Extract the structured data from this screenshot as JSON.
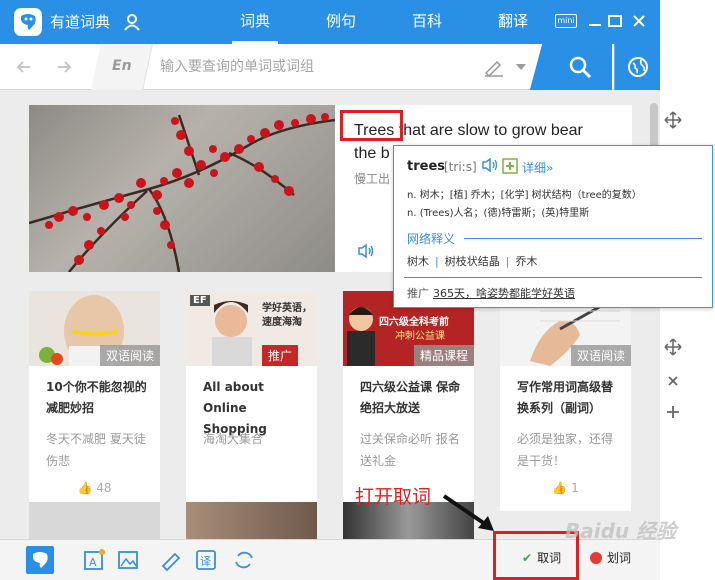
{
  "app": {
    "title": "有道词典"
  },
  "nav": {
    "tabs": [
      {
        "label": "词典"
      },
      {
        "label": "例句"
      },
      {
        "label": "百科"
      },
      {
        "label": "翻译"
      }
    ]
  },
  "window": {
    "mini_label": "mini"
  },
  "search": {
    "lang": "En",
    "placeholder": "输入要查询的单词或词组"
  },
  "feature": {
    "title": "Trees that are slow to grow bear",
    "title_line2": "the b",
    "subtitle": "慢工出"
  },
  "cards": [
    {
      "tag": "双语阅读",
      "title": "10个你不能忽视的减肥妙招",
      "desc": "冬天不减肥 夏天徒伤悲",
      "likes": "48"
    },
    {
      "tag": "推广",
      "title": "All about Online Shopping",
      "desc": "海淘大集合",
      "likes": "",
      "img_text1": "学好英语，",
      "img_text2": "速度海淘",
      "img_logo": "EF"
    },
    {
      "tag": "精品课程",
      "title": "四六级公益课 保命绝招大放送",
      "desc": "过关保命必听 报名送礼金",
      "likes": "",
      "img_text1": "四六级全科考前",
      "img_text2": "冲刺公益课"
    },
    {
      "tag": "双语阅读",
      "title": "写作常用词高级替换系列（副词）",
      "desc": "必须是独家，还得是干货！",
      "likes": "1"
    }
  ],
  "popup": {
    "word": "trees",
    "phonetic": "[tri:s]",
    "more": "详细»",
    "def1": "n. 树木；[植] 乔木；[化学] 树状结构（tree的复数）",
    "def2": "n. (Trees)人名；(德)特雷斯；(英)特里斯",
    "net_label": "网络释义",
    "net_items": [
      "树木",
      "树枝状结晶",
      "乔木"
    ],
    "promo_label": "推广",
    "promo_link": "365天，啥姿势都能学好英语"
  },
  "bottom": {
    "qu_ci": "取词",
    "hua_ci": "划词"
  },
  "annotation": {
    "text": "打开取词"
  },
  "watermark": {
    "text": "Baidu 经验"
  },
  "colors": {
    "brand": "#2a90e6",
    "annotation": "#e21d1d"
  }
}
